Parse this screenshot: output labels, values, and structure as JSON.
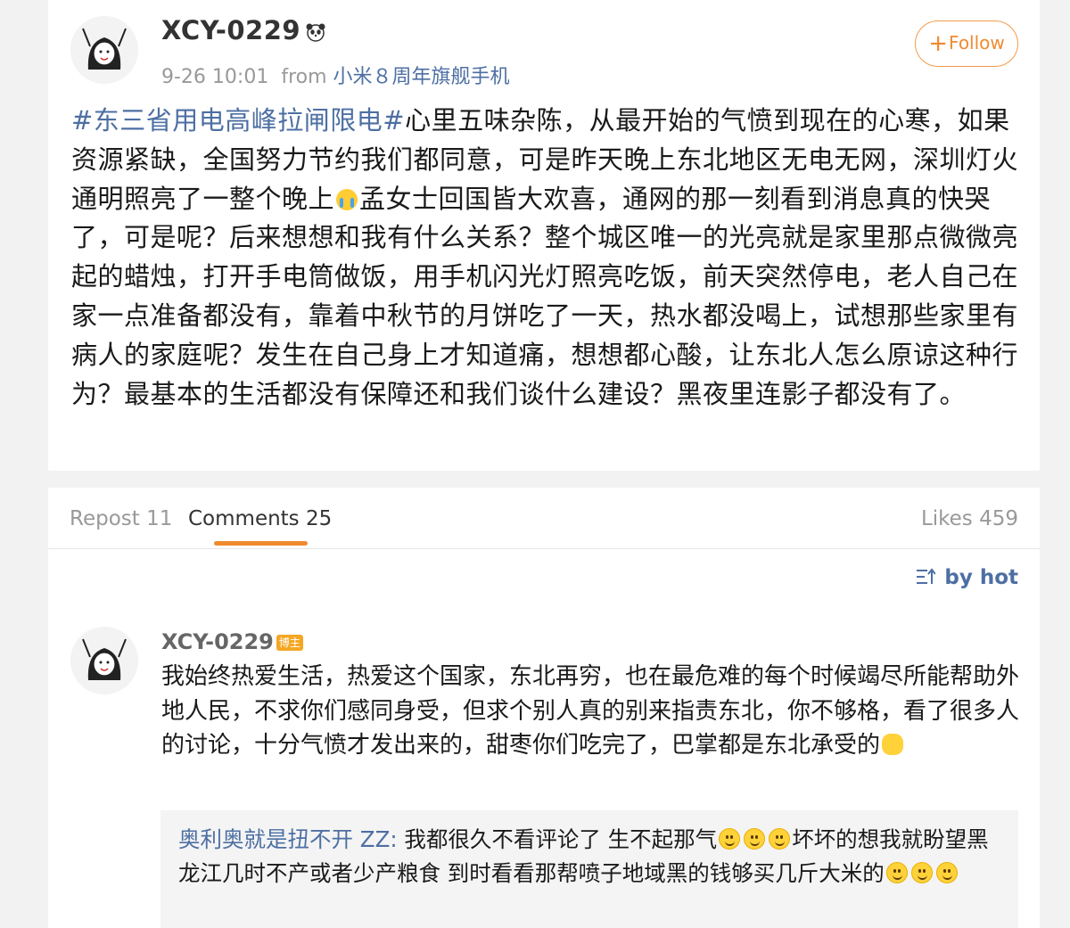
{
  "post": {
    "username": "XCY-0229",
    "timestamp": "9-26 10:01",
    "from_label": "from",
    "device": "小米８周年旗舰手机",
    "follow_label": "Follow",
    "hashtag": "#东三省用电高峰拉闸限电#",
    "text_part1": "心里五味杂陈，从最开始的气愤到现在的心寒，如果资源紧缺，全国努力节约我们都同意，可是昨天晚上东北地区无电无网，深圳灯火通明照亮了一整个晚上",
    "text_part2": "孟女士回国皆大欢喜，通网的那一刻看到消息真的快哭了，可是呢？后来想想和我有什么关系？整个城区唯一的光亮就是家里那点微微亮起的蜡烛，打开手电筒做饭，用手机闪光灯照亮吃饭，前天突然停电，老人自己在家一点准备都没有，靠着中秋节的月饼吃了一天，热水都没喝上，试想那些家里有病人的家庭呢？发生在自己身上才知道痛，想想都心酸，让东北人怎么原谅这种行为？最基本的生活都没有保障还和我们谈什么建设？黑夜里连影子都没有了。"
  },
  "tabs": {
    "repost": "Repost 11",
    "comments": "Comments 25",
    "likes": "Likes 459",
    "sort": "by hot"
  },
  "comment": {
    "username": "XCY-0229",
    "badge": "博主",
    "text": "我始终热爱生活，热爱这个国家，东北再穷，也在最危难的每个时候竭尽所能帮助外地人民，不求你们感同身受，但求个别人真的别来指责东北，你不够格，看了很多人的讨论，十分气愤才发出来的，甜枣你们吃完了，巴掌都是东北承受的",
    "reply": {
      "username": "奥利奥就是扭不开 ZZ:",
      "text_part1": " 我都很久不看评论了 生不起那气",
      "text_part2": "坏坏的想我就盼望黑龙江几时不产或者少产粮食 到时看看那帮喷子地域黑的钱够买几斤大米的"
    }
  },
  "colors": {
    "accent_orange": "#f08a30",
    "link_blue": "#4d6fa3"
  }
}
